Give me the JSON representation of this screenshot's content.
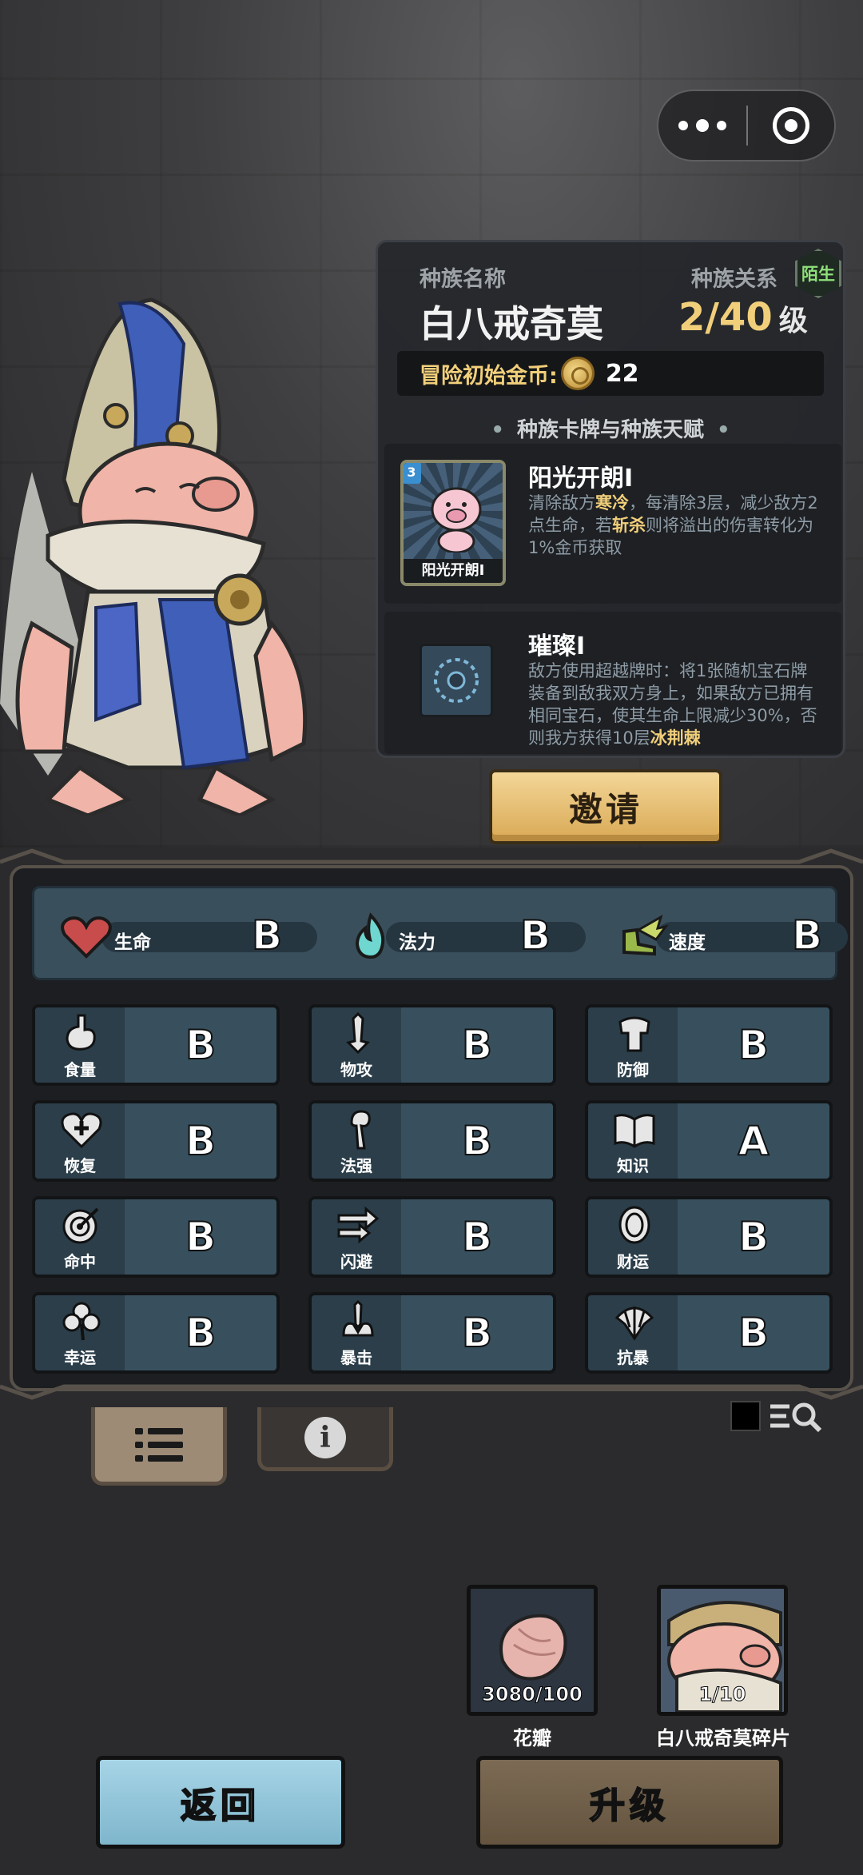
{
  "capsule": {
    "more_icon": "more-dots-icon",
    "close_icon": "target-close-icon"
  },
  "race": {
    "name_label": "种族名称",
    "name": "白八戒奇莫",
    "relation_label": "种族关系",
    "relation_badge": "陌生",
    "level": "2/40",
    "level_unit": "级",
    "gold_label": "冒险初始金币:",
    "gold_value": "22"
  },
  "section_title": "种族卡牌与种族天赋",
  "cards": [
    {
      "title": "阳光开朗I",
      "thumb_caption": "阳光开朗I",
      "cost": "3",
      "desc": [
        {
          "t": "清除敌方",
          "h": false
        },
        {
          "t": "寒冷",
          "h": true
        },
        {
          "t": "，每清除3层，减少敌方2点生命，若",
          "h": false
        },
        {
          "t": "斩杀",
          "h": true
        },
        {
          "t": "则将溢出的伤害转化为1%金币获取",
          "h": false
        }
      ]
    },
    {
      "title": "璀璨I",
      "desc": [
        {
          "t": "敌方使用超越牌时：将1张随机宝石牌装备到敌我双方身上，如果敌方已拥有相同宝石，使其生命上限减少30%，否则我方获得10层",
          "h": false
        },
        {
          "t": "冰荆棘",
          "h": true
        }
      ]
    }
  ],
  "invite_label": "邀请",
  "main_stats": [
    {
      "icon": "heart-icon",
      "label": "生命",
      "grade": "B",
      "color": "#c94c4c"
    },
    {
      "icon": "flame-icon",
      "label": "法力",
      "grade": "B",
      "color": "#6fd6d0"
    },
    {
      "icon": "winged-boot-icon",
      "label": "速度",
      "grade": "B",
      "color": "#9bb84a"
    }
  ],
  "stats": [
    {
      "icon": "stomach-icon",
      "label": "食量",
      "grade": "B"
    },
    {
      "icon": "sword-icon",
      "label": "物攻",
      "grade": "B"
    },
    {
      "icon": "armor-icon",
      "label": "防御",
      "grade": "B"
    },
    {
      "icon": "heart-plus-icon",
      "label": "恢复",
      "grade": "B"
    },
    {
      "icon": "staff-icon",
      "label": "法强",
      "grade": "B"
    },
    {
      "icon": "book-icon",
      "label": "知识",
      "grade": "A"
    },
    {
      "icon": "target-icon",
      "label": "命中",
      "grade": "B"
    },
    {
      "icon": "dash-arrows-icon",
      "label": "闪避",
      "grade": "B"
    },
    {
      "icon": "coin-icon",
      "label": "财运",
      "grade": "B"
    },
    {
      "icon": "clover-icon",
      "label": "幸运",
      "grade": "B"
    },
    {
      "icon": "crit-sword-icon",
      "label": "暴击",
      "grade": "B"
    },
    {
      "icon": "shell-icon",
      "label": "抗暴",
      "grade": "B"
    }
  ],
  "tabs": [
    {
      "icon": "list-icon"
    },
    {
      "icon": "info-icon",
      "glyph": "i"
    }
  ],
  "materials": [
    {
      "name": "花瓣",
      "count": "3080/100",
      "icon": "petal-icon"
    },
    {
      "name": "白八戒奇莫碎片",
      "count": "1/10",
      "icon": "pig-portrait-icon"
    }
  ],
  "buttons": {
    "back": "返回",
    "upgrade": "升级"
  }
}
